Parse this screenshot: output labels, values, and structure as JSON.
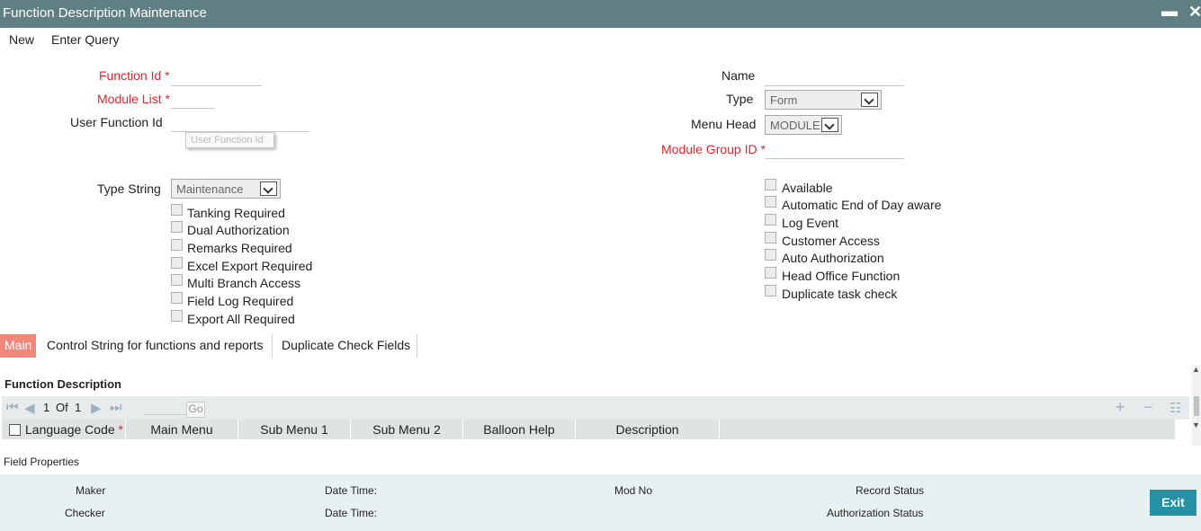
{
  "window": {
    "title": "Function Description Maintenance",
    "minimize_glyph": "▬",
    "close_glyph": "✕"
  },
  "menu": {
    "new": "New",
    "enter_query": "Enter Query"
  },
  "form": {
    "function_id": "Function Id",
    "module_list": "Module List",
    "user_function_id": "User Function Id",
    "user_function_id_tooltip": "User Function Id",
    "name": "Name",
    "type": "Type",
    "type_value": "Form",
    "menu_head": "Menu Head",
    "menu_head_value": "MODULE",
    "module_group_id": "Module Group ID",
    "type_string": "Type String",
    "type_string_value": "Maintenance",
    "required_mark": "*"
  },
  "checkboxes_left": [
    "Tanking Required",
    "Dual Authorization",
    "Remarks Required",
    "Excel Export Required",
    "Multi Branch Access",
    "Field Log Required",
    "Export All Required"
  ],
  "checkboxes_right": [
    "Available",
    "Automatic End of Day aware",
    "Log Event",
    "Customer Access",
    "Auto Authorization",
    "Head Office Function",
    "Duplicate task check"
  ],
  "tabs": [
    "Main",
    "Control String for functions and reports",
    "Duplicate Check Fields"
  ],
  "grid": {
    "section_title": "Function Description",
    "page_current": "1",
    "page_of": "Of",
    "page_total": "1",
    "go": "Go",
    "columns": [
      "Language Code",
      "Main Menu",
      "Sub Menu 1",
      "Sub Menu 2",
      "Balloon Help",
      "Description"
    ],
    "icons": [
      "first-page-icon",
      "prev-page-icon",
      "next-page-icon",
      "last-page-icon",
      "add-row-icon",
      "delete-row-icon",
      "list-view-icon"
    ]
  },
  "field_properties": "Field Properties",
  "audit": {
    "maker": "Maker",
    "checker": "Checker",
    "date_time_1": "Date Time:",
    "date_time_2": "Date Time:",
    "mod_no": "Mod No",
    "record_status": "Record Status",
    "authorization_status": "Authorization Status",
    "exit": "Exit"
  },
  "colors": {
    "titlebar": "#5f7f82",
    "required": "#e0262e",
    "active_tab": "#f0877a",
    "exit_button": "#2492a4",
    "audit_bg": "#e7f1f2"
  }
}
